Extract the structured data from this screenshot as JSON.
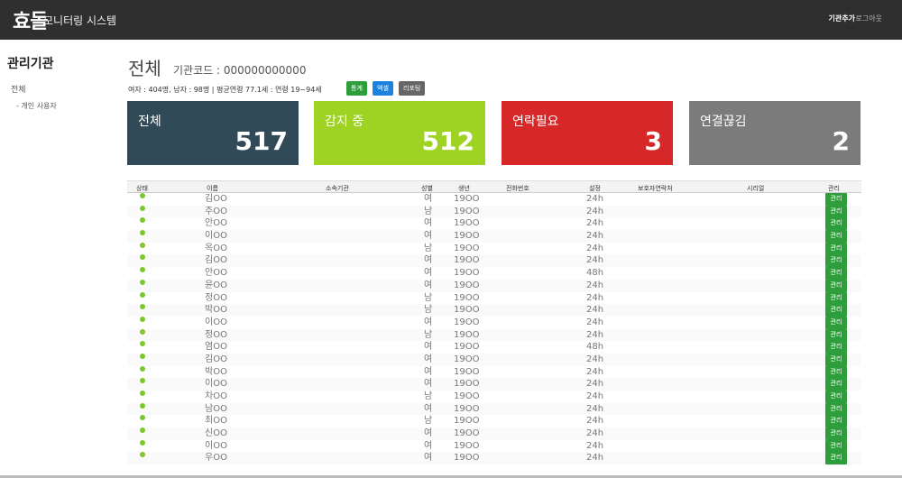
{
  "header": {
    "logo": "효돌",
    "app_title": "모니터링 시스템",
    "add_org": "기관추가",
    "logout": "로그아웃"
  },
  "sidebar": {
    "title": "관리기관",
    "items": [
      {
        "label": "전체"
      },
      {
        "label": "- 개인 사용자"
      }
    ]
  },
  "main": {
    "title": "전체",
    "org_code": "기관코드 : 000000000000",
    "stats": "여자 : 404명, 남자 : 98명 | 평균연령 77.1세 : 연령 19~94세",
    "buttons": {
      "stats": "통계",
      "excel": "엑셀",
      "report": "리포팅"
    }
  },
  "cards": [
    {
      "label": "전체",
      "value": "517",
      "color": "#304a57"
    },
    {
      "label": "감지 중",
      "value": "512",
      "color": "#9ed323"
    },
    {
      "label": "연락필요",
      "value": "3",
      "color": "#d62828"
    },
    {
      "label": "연결끊김",
      "value": "2",
      "color": "#7b7b7b"
    }
  ],
  "table": {
    "columns": [
      "상태",
      "이름",
      "소속기관",
      "성별",
      "생년",
      "전화번호",
      "설정",
      "보호자연락처",
      "시리얼",
      "관리"
    ],
    "manage_label": "관리",
    "rows": [
      {
        "name": "김OO",
        "gender": "여",
        "birth": "19OO",
        "setting": "24h"
      },
      {
        "name": "주OO",
        "gender": "남",
        "birth": "19OO",
        "setting": "24h"
      },
      {
        "name": "안OO",
        "gender": "여",
        "birth": "19OO",
        "setting": "24h"
      },
      {
        "name": "이OO",
        "gender": "여",
        "birth": "19OO",
        "setting": "24h"
      },
      {
        "name": "옥OO",
        "gender": "남",
        "birth": "19OO",
        "setting": "24h"
      },
      {
        "name": "김OO",
        "gender": "여",
        "birth": "19OO",
        "setting": "24h"
      },
      {
        "name": "안OO",
        "gender": "여",
        "birth": "19OO",
        "setting": "48h"
      },
      {
        "name": "윤OO",
        "gender": "여",
        "birth": "19OO",
        "setting": "24h"
      },
      {
        "name": "정OO",
        "gender": "남",
        "birth": "19OO",
        "setting": "24h"
      },
      {
        "name": "박OO",
        "gender": "남",
        "birth": "19OO",
        "setting": "24h"
      },
      {
        "name": "이OO",
        "gender": "여",
        "birth": "19OO",
        "setting": "24h"
      },
      {
        "name": "정OO",
        "gender": "남",
        "birth": "19OO",
        "setting": "24h"
      },
      {
        "name": "염OO",
        "gender": "여",
        "birth": "19OO",
        "setting": "48h"
      },
      {
        "name": "김OO",
        "gender": "여",
        "birth": "19OO",
        "setting": "24h"
      },
      {
        "name": "박OO",
        "gender": "여",
        "birth": "19OO",
        "setting": "24h"
      },
      {
        "name": "이OO",
        "gender": "여",
        "birth": "19OO",
        "setting": "24h"
      },
      {
        "name": "차OO",
        "gender": "남",
        "birth": "19OO",
        "setting": "24h"
      },
      {
        "name": "남OO",
        "gender": "여",
        "birth": "19OO",
        "setting": "24h"
      },
      {
        "name": "최OO",
        "gender": "남",
        "birth": "19OO",
        "setting": "24h"
      },
      {
        "name": "신OO",
        "gender": "여",
        "birth": "19OO",
        "setting": "24h"
      },
      {
        "name": "이OO",
        "gender": "여",
        "birth": "19OO",
        "setting": "24h"
      },
      {
        "name": "우OO",
        "gender": "여",
        "birth": "19OO",
        "setting": "24h"
      }
    ]
  }
}
